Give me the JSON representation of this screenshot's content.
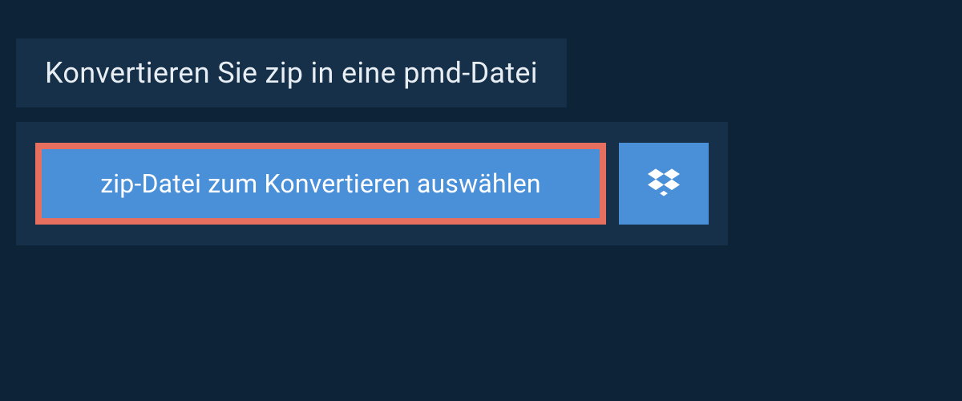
{
  "header": {
    "title": "Konvertieren Sie zip in eine pmd-Datei"
  },
  "actions": {
    "select_file_label": "zip-Datei zum Konvertieren auswählen",
    "dropbox_icon": "dropbox"
  },
  "colors": {
    "page_bg": "#0d2438",
    "panel_bg": "#153048",
    "button_bg": "#4a90d9",
    "highlight_border": "#e76f5f",
    "text_light": "#e8eef3"
  }
}
